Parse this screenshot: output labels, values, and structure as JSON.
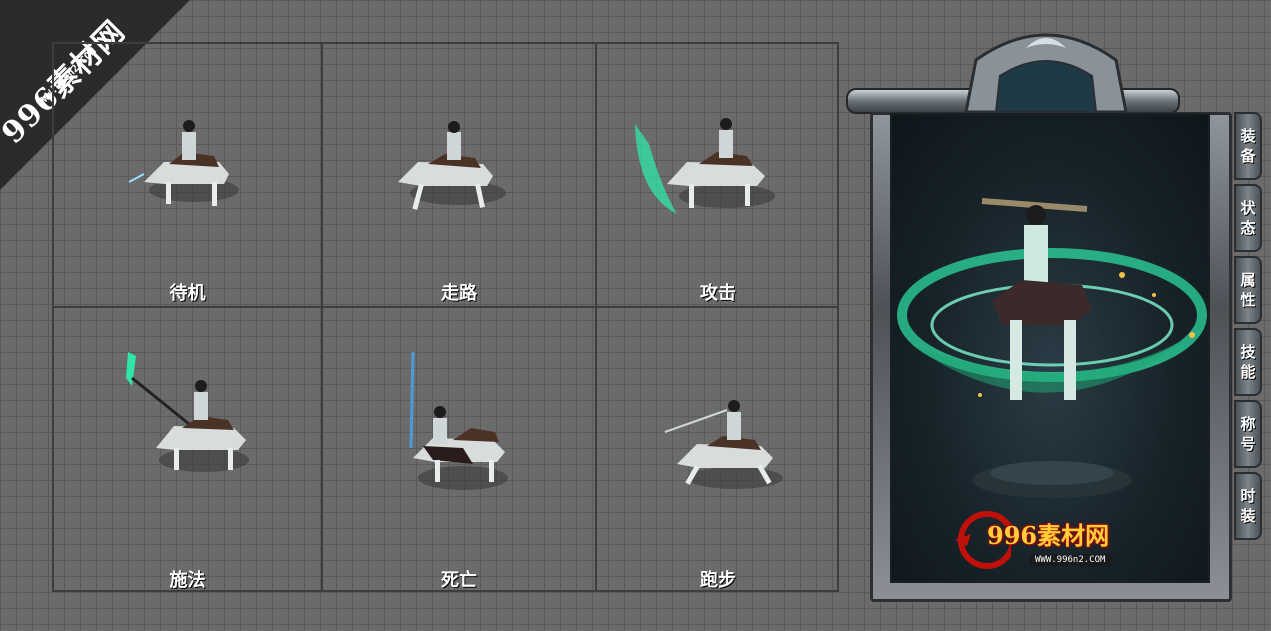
{
  "watermark": {
    "text": "996素材网",
    "url": "WWW.996n2.COM"
  },
  "animations": [
    {
      "label": "待机"
    },
    {
      "label": "走路"
    },
    {
      "label": "攻击"
    },
    {
      "label": "施法"
    },
    {
      "label": "死亡"
    },
    {
      "label": "跑步"
    }
  ],
  "panel": {
    "tabs": [
      {
        "top": "装",
        "bottom": "备"
      },
      {
        "top": "状",
        "bottom": "态"
      },
      {
        "top": "属",
        "bottom": "性"
      },
      {
        "top": "技",
        "bottom": "能"
      },
      {
        "top": "称",
        "bottom": "号"
      },
      {
        "top": "时",
        "bottom": "装"
      }
    ],
    "logo": {
      "text": "996素材网",
      "url": "WWW.996n2.COM"
    }
  },
  "colors": {
    "accent_glow": "#2fe6a8",
    "frame_dark": "#2c3034"
  }
}
